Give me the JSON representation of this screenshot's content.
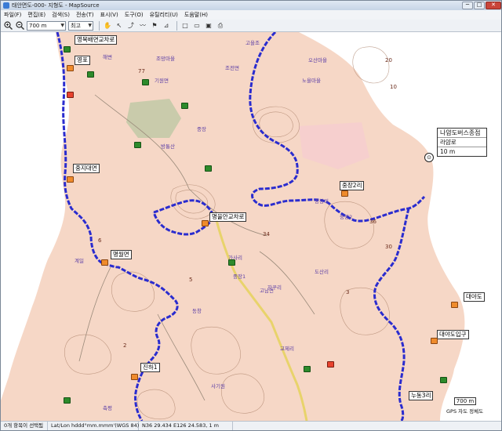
{
  "window": {
    "title": "태안면도-000- 지형도 - MapSource",
    "close_glyph": "✕",
    "minimize_glyph": "─",
    "maximize_glyph": "□"
  },
  "menu": [
    "파일(F)",
    "편집(E)",
    "검색(S)",
    "전송(T)",
    "표시(V)",
    "도구(O)",
    "유틸리티(U)",
    "도움말(H)"
  ],
  "toolbar": {
    "zoom_value": "700 m",
    "detail_value": "최고",
    "icons": [
      "zoom-in-icon",
      "zoom-out-icon",
      "hand-tool-icon",
      "select-icon",
      "route-icon",
      "track-icon",
      "waypoint-icon",
      "measure-icon",
      "new-file-icon",
      "open-file-icon",
      "save-icon",
      "print-icon"
    ]
  },
  "map": {
    "place_labels": [
      {
        "text": "해변"
      },
      {
        "text": "조망마을"
      },
      {
        "text": "고을조"
      },
      {
        "text": "오산마을"
      },
      {
        "text": "노을마을"
      },
      {
        "text": "기원면"
      },
      {
        "text": "조전면"
      },
      {
        "text": "중장"
      },
      {
        "text": "방통산"
      },
      {
        "text": "중장리"
      },
      {
        "text": "가사리"
      },
      {
        "text": "고남면"
      },
      {
        "text": "사기원"
      },
      {
        "text": "축평"
      },
      {
        "text": "계일"
      },
      {
        "text": "중장1"
      },
      {
        "text": "동창"
      },
      {
        "text": "교제리"
      },
      {
        "text": "자꾸리"
      },
      {
        "text": "도산리"
      },
      {
        "text": "중장2"
      }
    ],
    "box_labels": {
      "top_junction": "영목배면교차로",
      "west_market": "영포",
      "west_crossing": "중지대면",
      "center_junction": "명을안교차로",
      "south_west": "명월면",
      "east_village": "중장2리",
      "south_village": "진하1",
      "east_point": "대야도",
      "east_port": "대야도입구",
      "south_east": "누동3리"
    },
    "numbers": [
      "77",
      "20",
      "10",
      "6",
      "34",
      "5",
      "2",
      "36",
      "30",
      "3"
    ],
    "bus_stop": {
      "name": "나얌도버스종점",
      "sub_label": "라얌로",
      "distance": "10 m"
    },
    "scale_label": "700 m",
    "gps_status": "GPS 자도 정체도"
  },
  "status": {
    "selection": "0개 항목이 선택됨",
    "position_label": "Lat/Lon hddd°mm.mmm'(WGS 84)",
    "coords": "N36 29.434 E126 24.583, 1 m"
  },
  "colors": {
    "land": "#f6d7c6",
    "sea": "#ffffff",
    "route": "#2a2ccf",
    "highway": "#e8d36b",
    "contour": "#a57b63"
  }
}
